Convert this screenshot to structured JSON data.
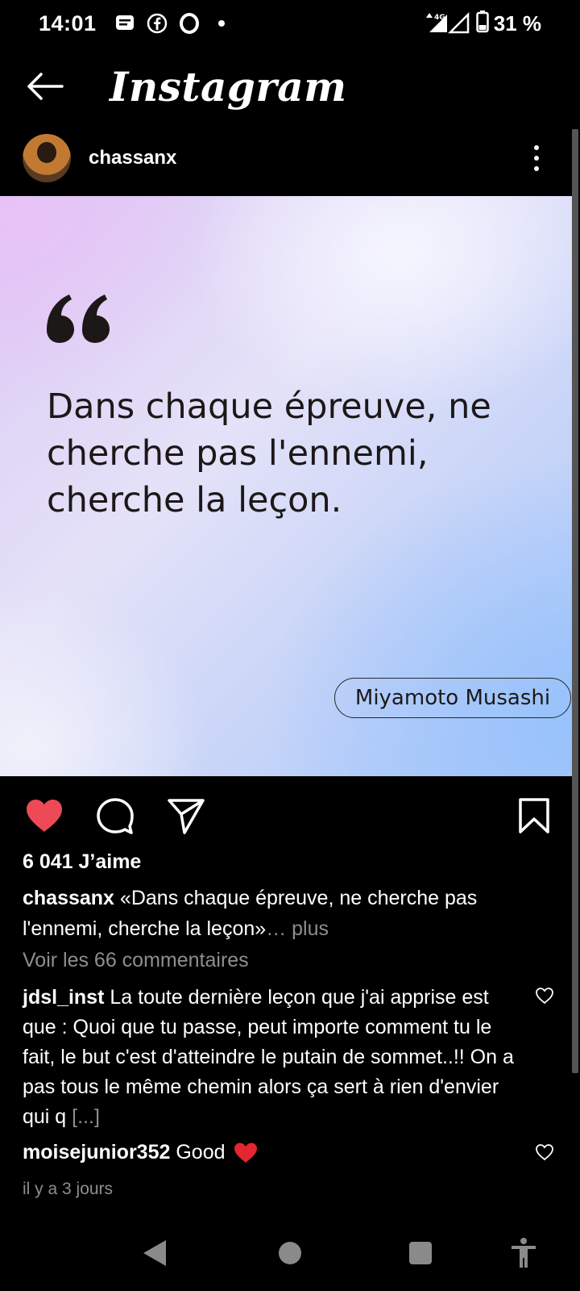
{
  "status_bar": {
    "time": "14:01",
    "network": "4G",
    "battery": "31 %",
    "icons": [
      "message-icon",
      "facebook-icon",
      "opera-icon",
      "dot-icon",
      "signal-icon",
      "battery-icon"
    ]
  },
  "header": {
    "title": "Instagram",
    "back_icon": "arrow-left-icon"
  },
  "post": {
    "username": "chassanx",
    "quote_lines": [
      "Dans chaque épreuve, ne",
      "cherche pas l'ennemi,",
      "cherche la leçon."
    ],
    "author": "Miyamoto Musashi",
    "likes": "6 041 J’aime",
    "caption_user": "chassanx",
    "caption_text": "«Dans chaque épreuve, ne cherche pas l'ennemi, cherche la leçon»",
    "caption_more": "… plus",
    "view_comments": "Voir les 66 commentaires",
    "liked": true
  },
  "comments": [
    {
      "user": "jdsl_inst",
      "text": "La toute dernière leçon que j'ai apprise est que : Quoi que tu passe, peut importe comment tu le fait, le but c'est d'atteindre le putain de sommet..!! On a pas tous le même chemin alors ça sert à rien d'envier qui q",
      "more": "[...]"
    },
    {
      "user": "moisejunior352",
      "text": "Good"
    }
  ],
  "time_ago": "il y a 3 jours",
  "colors": {
    "like_red": "#ED4956",
    "muted": "#8E8E8E",
    "background": "#000000"
  }
}
